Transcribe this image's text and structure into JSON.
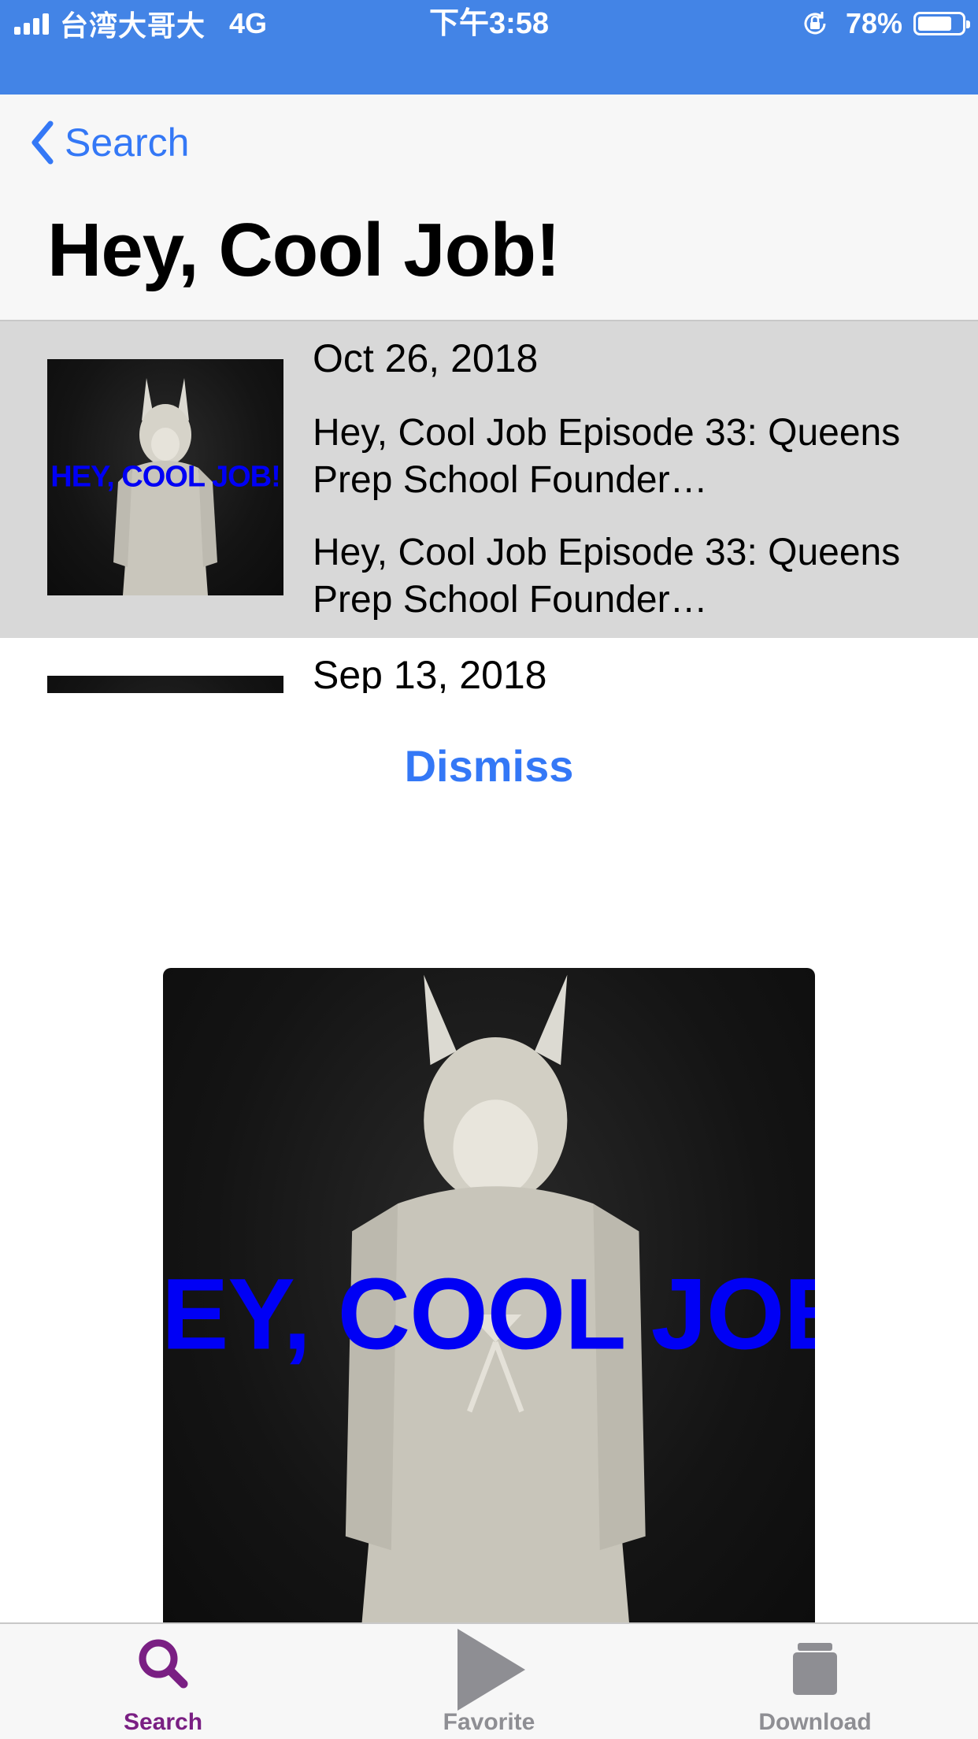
{
  "status_bar": {
    "carrier": "台湾大哥大",
    "network": "4G",
    "time": "下午3:58",
    "battery_percent": "78%",
    "battery_level": 0.78,
    "icons": [
      "signal-icon",
      "rotation-lock-icon",
      "battery-icon"
    ]
  },
  "nav": {
    "back_label": "Search",
    "title": "Hey, Cool Job!"
  },
  "episodes": [
    {
      "date": "Oct 26, 2018",
      "title": "Hey, Cool Job Episode 33: Queens Prep School Founder…",
      "description": "Hey, Cool Job Episode 33: Queens Prep School Founder…",
      "cover_text": "HEY, COOL JOB!"
    },
    {
      "date": "Sep 13, 2018",
      "cover_text": ""
    }
  ],
  "dismiss_label": "Dismiss",
  "artwork": {
    "cover_text": "HEY, COOL JOB!"
  },
  "tab_bar": {
    "tabs": [
      {
        "label": "Search",
        "icon": "search-icon",
        "active": true
      },
      {
        "label": "Favorite",
        "icon": "play-icon",
        "active": false
      },
      {
        "label": "Download",
        "icon": "download-icon",
        "active": false
      }
    ]
  },
  "colors": {
    "status_bar": "#4384e6",
    "accent": "#3478f6",
    "tab_active": "#7a1f83",
    "tab_inactive": "#8e8e93",
    "cover_text": "#0000f5",
    "selected_row": "#d8d8d8"
  }
}
